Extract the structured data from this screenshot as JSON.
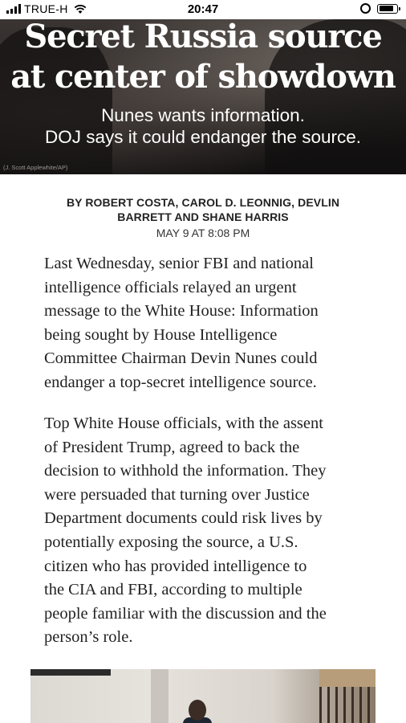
{
  "status_bar": {
    "carrier": "TRUE-H",
    "time": "20:47",
    "battery_level": 0.85
  },
  "hero": {
    "title_lines": [
      "Secret Russia source",
      "at center of showdown"
    ],
    "subtitle_lines": [
      "Nunes wants information.",
      "DOJ says it could endanger the source."
    ],
    "photo_credit": "(J. Scott Applewhite/AP)"
  },
  "article": {
    "byline_lines": [
      "BY ROBERT COSTA, CAROL D. LEONNIG, DEVLIN",
      "BARRETT AND SHANE HARRIS"
    ],
    "dateline": "MAY 9 AT 8:08 PM",
    "paragraph1_lines": [
      "Last Wednesday, senior FBI and national",
      "intelligence officials relayed an urgent",
      "message to the White House: Information",
      "being sought by House Intelligence",
      "Committee Chairman Devin Nunes could",
      "endanger a top-secret intelligence source."
    ],
    "paragraph2_lines": [
      "Top White House officials, with the assent",
      "of President Trump, agreed to back the",
      "decision to withhold the information. They",
      "were persuaded that turning over Justice",
      "Department documents could risk lives by",
      "potentially exposing the source, a U.S.",
      "citizen who has provided intelligence to",
      "the CIA and FBI, according to multiple",
      "people familiar with the discussion and the",
      "person’s role."
    ]
  }
}
